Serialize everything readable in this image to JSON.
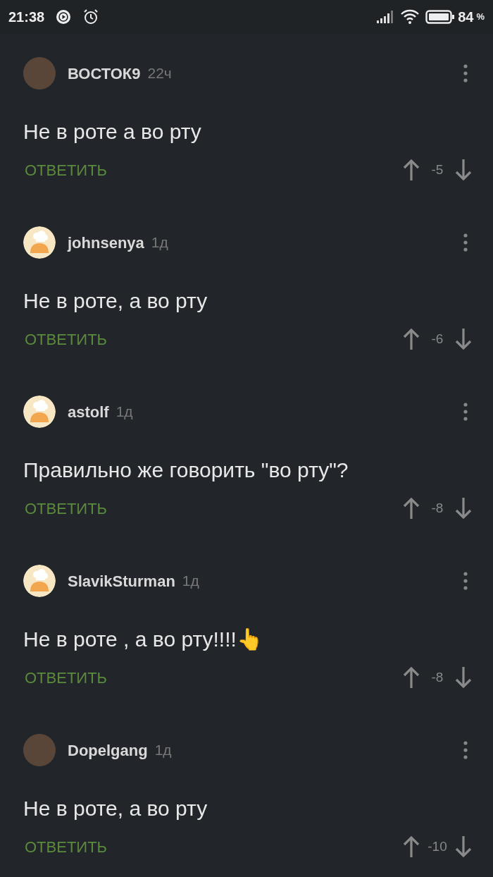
{
  "status_bar": {
    "time": "21:38",
    "battery_percent": "84",
    "percent_sign": "%"
  },
  "comments": [
    {
      "author": "ВОСТОК9",
      "time": "22ч",
      "avatar": {
        "kind": "photo"
      },
      "text": "Не в роте а во рту",
      "reply": "ОТВЕТИТЬ",
      "score": "-5"
    },
    {
      "author": "johnsenya",
      "time": "1д",
      "avatar": {
        "kind": "default"
      },
      "text": "Не в роте, а во рту",
      "reply": "ОТВЕТИТЬ",
      "score": "-6"
    },
    {
      "author": "astolf",
      "time": "1д",
      "avatar": {
        "kind": "default"
      },
      "text": "Правильно же говорить \"во рту\"?",
      "reply": "ОТВЕТИТЬ",
      "score": "-8"
    },
    {
      "author": "SlavikSturman",
      "time": "1д",
      "avatar": {
        "kind": "default"
      },
      "text": "Не в роте , а во рту!!!!👆",
      "reply": "ОТВЕТИТЬ",
      "score": "-8"
    },
    {
      "author": "Dopelgang",
      "time": "1д",
      "avatar": {
        "kind": "photo"
      },
      "text": "Не в роте, а во рту",
      "reply": "ОТВЕТИТЬ",
      "score": "-10"
    }
  ]
}
